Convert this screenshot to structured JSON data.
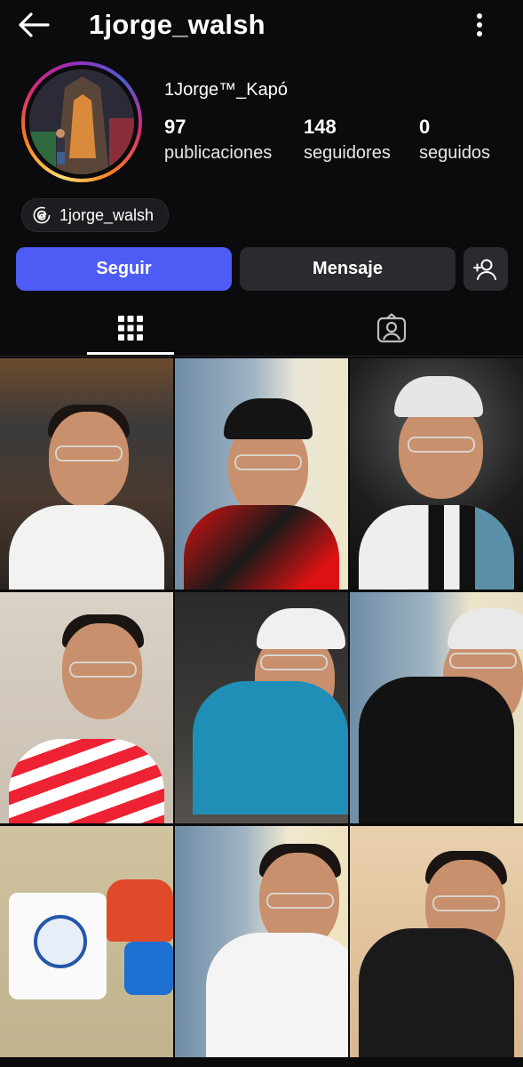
{
  "header": {
    "username": "1jorge_walsh"
  },
  "profile": {
    "display_name": "1Jorge™_Kapó",
    "stats": [
      {
        "value": "97",
        "label": "publicaciones"
      },
      {
        "value": "148",
        "label": "seguidores"
      },
      {
        "value": "0",
        "label": "seguidos"
      }
    ],
    "threads_handle": "1jorge_walsh"
  },
  "actions": {
    "follow_label": "Seguir",
    "message_label": "Mensaje"
  },
  "colors": {
    "accent": "#4f5bf5",
    "background": "#0b0b0d",
    "button": "#2a2b30"
  },
  "icons": [
    "back-arrow-icon",
    "more-vertical-icon",
    "threads-icon",
    "add-person-icon",
    "grid-icon",
    "tagged-icon"
  ],
  "posts_count_visible": 9
}
